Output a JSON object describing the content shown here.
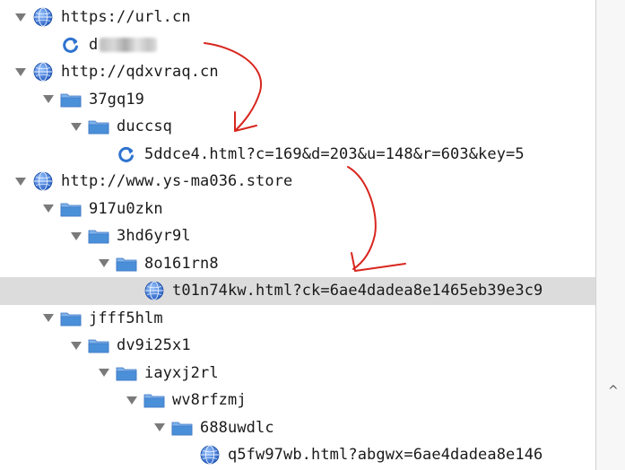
{
  "tree": {
    "rows": [
      {
        "label": "https://url.cn",
        "type": "domain",
        "depth": 0,
        "twisty": true
      },
      {
        "label": "d",
        "type": "request",
        "depth": 1,
        "twisty": false,
        "blurred": true
      },
      {
        "label": "http://qdxvraq.cn",
        "type": "domain",
        "depth": 0,
        "twisty": true
      },
      {
        "label": "37gq19",
        "type": "folder",
        "depth": 1,
        "twisty": true
      },
      {
        "label": "duccsq",
        "type": "folder",
        "depth": 2,
        "twisty": true
      },
      {
        "label": "5ddce4.html?c=169&d=203&u=148&r=603&key=5",
        "type": "request",
        "depth": 3,
        "twisty": false
      },
      {
        "label": "http://www.ys-ma036.store",
        "type": "domain",
        "depth": 0,
        "twisty": true
      },
      {
        "label": "917u0zkn",
        "type": "folder",
        "depth": 1,
        "twisty": true
      },
      {
        "label": "3hd6yr9l",
        "type": "folder",
        "depth": 2,
        "twisty": true
      },
      {
        "label": "8o161rn8",
        "type": "folder",
        "depth": 3,
        "twisty": true
      },
      {
        "label": "t01n74kw.html?ck=6ae4dadea8e1465eb39e3c9",
        "type": "page",
        "depth": 4,
        "twisty": false,
        "selected": true
      },
      {
        "label": "jfff5hlm",
        "type": "folder",
        "depth": 1,
        "twisty": true
      },
      {
        "label": "dv9i25x1",
        "type": "folder",
        "depth": 2,
        "twisty": true
      },
      {
        "label": "iayxj2rl",
        "type": "folder",
        "depth": 3,
        "twisty": true
      },
      {
        "label": "wv8rfzmj",
        "type": "folder",
        "depth": 4,
        "twisty": true
      },
      {
        "label": "688uwdlc",
        "type": "folder",
        "depth": 5,
        "twisty": true
      },
      {
        "label": "q5fw97wb.html?abgwx=6ae4dadea8e146",
        "type": "page",
        "depth": 6,
        "twisty": false
      }
    ]
  },
  "scrollbar": {
    "caret": "^"
  },
  "colors": {
    "selected_row": "#dcdcdc",
    "annotation": "#d8261f",
    "folder": "#4a90d9",
    "globe": "#2a6fcf"
  }
}
